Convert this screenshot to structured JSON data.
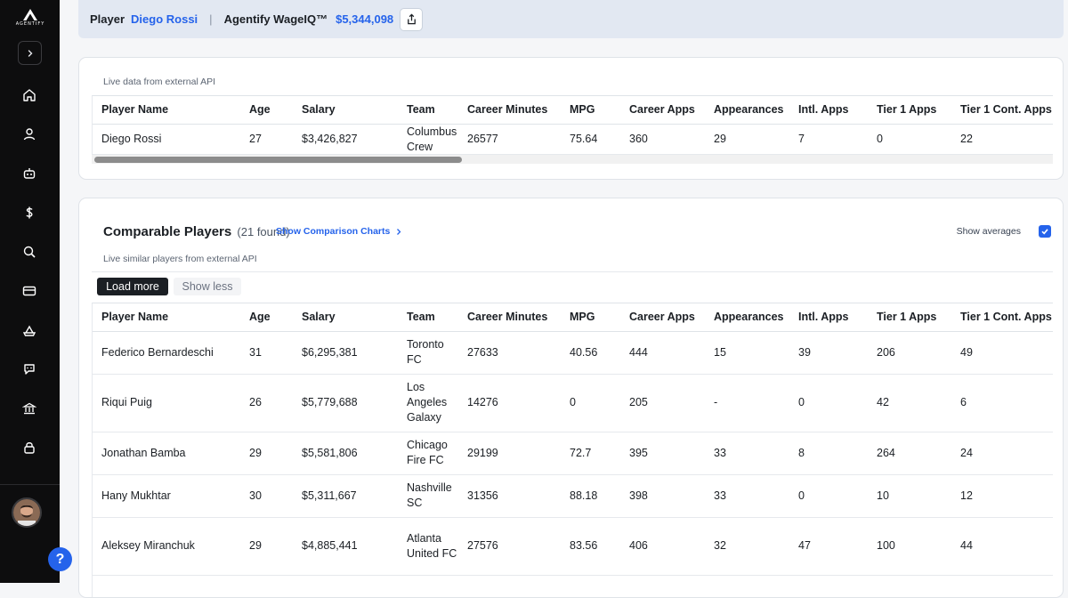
{
  "sidebar": {
    "logo_text": "AGENTIFY",
    "nav_icons": [
      "home-icon",
      "user-icon",
      "robot-icon",
      "dollar-icon",
      "search-icon",
      "card-icon",
      "ship-icon",
      "chat-icon",
      "bank-icon",
      "lock-icon"
    ]
  },
  "topbar": {
    "player_label": "Player",
    "player_name": "Diego Rossi",
    "separator": "|",
    "wage_label": "Agentify WageIQ™",
    "wage_value": "$5,344,098"
  },
  "player_card": {
    "caption": "Live data from external API",
    "columns": [
      "Player Name",
      "Age",
      "Salary",
      "Team",
      "Career Minutes",
      "MPG",
      "Career Apps",
      "Appearances",
      "Intl. Apps",
      "Tier 1 Apps",
      "Tier 1 Cont. Apps"
    ],
    "row": [
      "Diego Rossi",
      "27",
      "$3,426,827",
      "Columbus Crew",
      "26577",
      "75.64",
      "360",
      "29",
      "7",
      "0",
      "22"
    ]
  },
  "comparable": {
    "title": "Comparable Players",
    "count": "(21 found)",
    "charts_link": "Show Comparison Charts",
    "caption": "Live similar players from external API",
    "show_averages_label": "Show averages",
    "show_averages_checked": true,
    "load_more_label": "Load more",
    "show_less_label": "Show less",
    "columns": [
      "Player Name",
      "Age",
      "Salary",
      "Team",
      "Career Minutes",
      "MPG",
      "Career Apps",
      "Appearances",
      "Intl. Apps",
      "Tier 1 Apps",
      "Tier 1 Cont. Apps"
    ],
    "rows": [
      [
        "Federico Bernardeschi",
        "31",
        "$6,295,381",
        "Toronto FC",
        "27633",
        "40.56",
        "444",
        "15",
        "39",
        "206",
        "49"
      ],
      [
        "Riqui Puig",
        "26",
        "$5,779,688",
        "Los Angeles Galaxy",
        "14276",
        "0",
        "205",
        "-",
        "0",
        "42",
        "6"
      ],
      [
        "Jonathan Bamba",
        "29",
        "$5,581,806",
        "Chicago Fire FC",
        "29199",
        "72.7",
        "395",
        "33",
        "8",
        "264",
        "24"
      ],
      [
        "Hany Mukhtar",
        "30",
        "$5,311,667",
        "Nashville SC",
        "31356",
        "88.18",
        "398",
        "33",
        "0",
        "10",
        "12"
      ],
      [
        "Aleksey Miranchuk",
        "29",
        "$4,885,441",
        "Atlanta United FC",
        "27576",
        "83.56",
        "406",
        "32",
        "47",
        "100",
        "44"
      ]
    ]
  },
  "help_label": "?",
  "colors": {
    "accent": "#2563eb",
    "sidebar_bg": "#0d0d0e",
    "topbar_bg": "#e2e8f2"
  }
}
